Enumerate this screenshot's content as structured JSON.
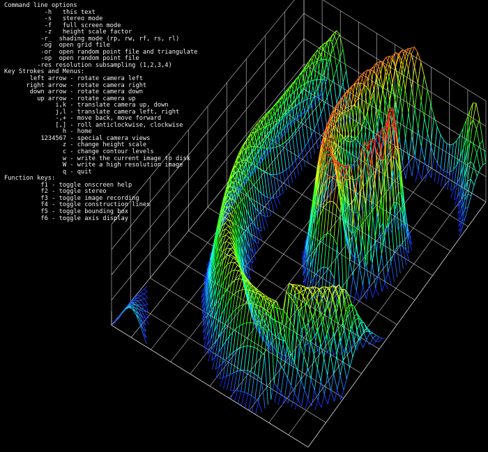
{
  "help_overlay": {
    "sections": [
      {
        "title": "Command line options",
        "items": [
          {
            "key": "-h",
            "sep": "   ",
            "desc": "this text"
          },
          {
            "key": "-s",
            "sep": "   ",
            "desc": "stereo mode"
          },
          {
            "key": "-f",
            "sep": "   ",
            "desc": "full screen mode"
          },
          {
            "key": "-z",
            "sep": "   ",
            "desc": "height scale factor"
          },
          {
            "key": "-r_",
            "sep": "  ",
            "desc": "shading mode (rp, rw, rf, rs, rl)"
          },
          {
            "key": "-og",
            "sep": "  ",
            "desc": "open grid file"
          },
          {
            "key": "-or",
            "sep": "  ",
            "desc": "open random point file and triangulate"
          },
          {
            "key": "-op",
            "sep": "  ",
            "desc": "open random point file"
          },
          {
            "key": "-res",
            "sep": " ",
            "desc": "resolution subsampling (1,2,3,4)"
          }
        ]
      },
      {
        "title": "Key Strokes and Menus:",
        "items": [
          {
            "key": "left arrow",
            "sep": " - ",
            "desc": "rotate camera left"
          },
          {
            "key": "right arrow",
            "sep": " - ",
            "desc": "rotate camera right"
          },
          {
            "key": "down arrow",
            "sep": " - ",
            "desc": "rotate camera down"
          },
          {
            "key": "up arrow",
            "sep": " - ",
            "desc": "rotate camera up"
          },
          {
            "key": "i,k",
            "sep": " - ",
            "desc": "translate camera up, down"
          },
          {
            "key": "j,l",
            "sep": " - ",
            "desc": "translate camera left, right"
          },
          {
            "key": "-,+",
            "sep": " - ",
            "desc": "move back, move forward"
          },
          {
            "key": "[,]",
            "sep": " - ",
            "desc": "roll anticlockwise, clockwise"
          },
          {
            "key": "h",
            "sep": " - ",
            "desc": "home"
          },
          {
            "key": "1234567",
            "sep": " - ",
            "desc": "special camera views"
          },
          {
            "key": "z",
            "sep": " - ",
            "desc": "change height scale"
          },
          {
            "key": "c",
            "sep": " - ",
            "desc": "change contour levels"
          },
          {
            "key": "w",
            "sep": " - ",
            "desc": "write the current image to disk"
          },
          {
            "key": "W",
            "sep": " - ",
            "desc": "write a high resolution image"
          },
          {
            "key": "q",
            "sep": " - ",
            "desc": "quit"
          }
        ]
      },
      {
        "title": "Function keys:",
        "items": [
          {
            "key": "f1",
            "sep": " - ",
            "desc": "toggle onscreen help"
          },
          {
            "key": "f2",
            "sep": " - ",
            "desc": "toggle stereo"
          },
          {
            "key": "f3",
            "sep": " - ",
            "desc": "toggle image recording"
          },
          {
            "key": "f4",
            "sep": " - ",
            "desc": "toggle construction lines"
          },
          {
            "key": "f5",
            "sep": " - ",
            "desc": "toggle bounding box"
          },
          {
            "key": "f6",
            "sep": " - ",
            "desc": "toggle axis display"
          }
        ]
      }
    ]
  },
  "colors": {
    "background": "#000000",
    "text": "#f2f2f2",
    "bounding_box": "#d0d0d0",
    "surface_low": "#1030ff",
    "surface_high": "#ff2020"
  },
  "surface": {
    "rendering": "wireframe grid surface",
    "shading": "height-based rainbow coloring",
    "bounding_box_visible": true
  }
}
